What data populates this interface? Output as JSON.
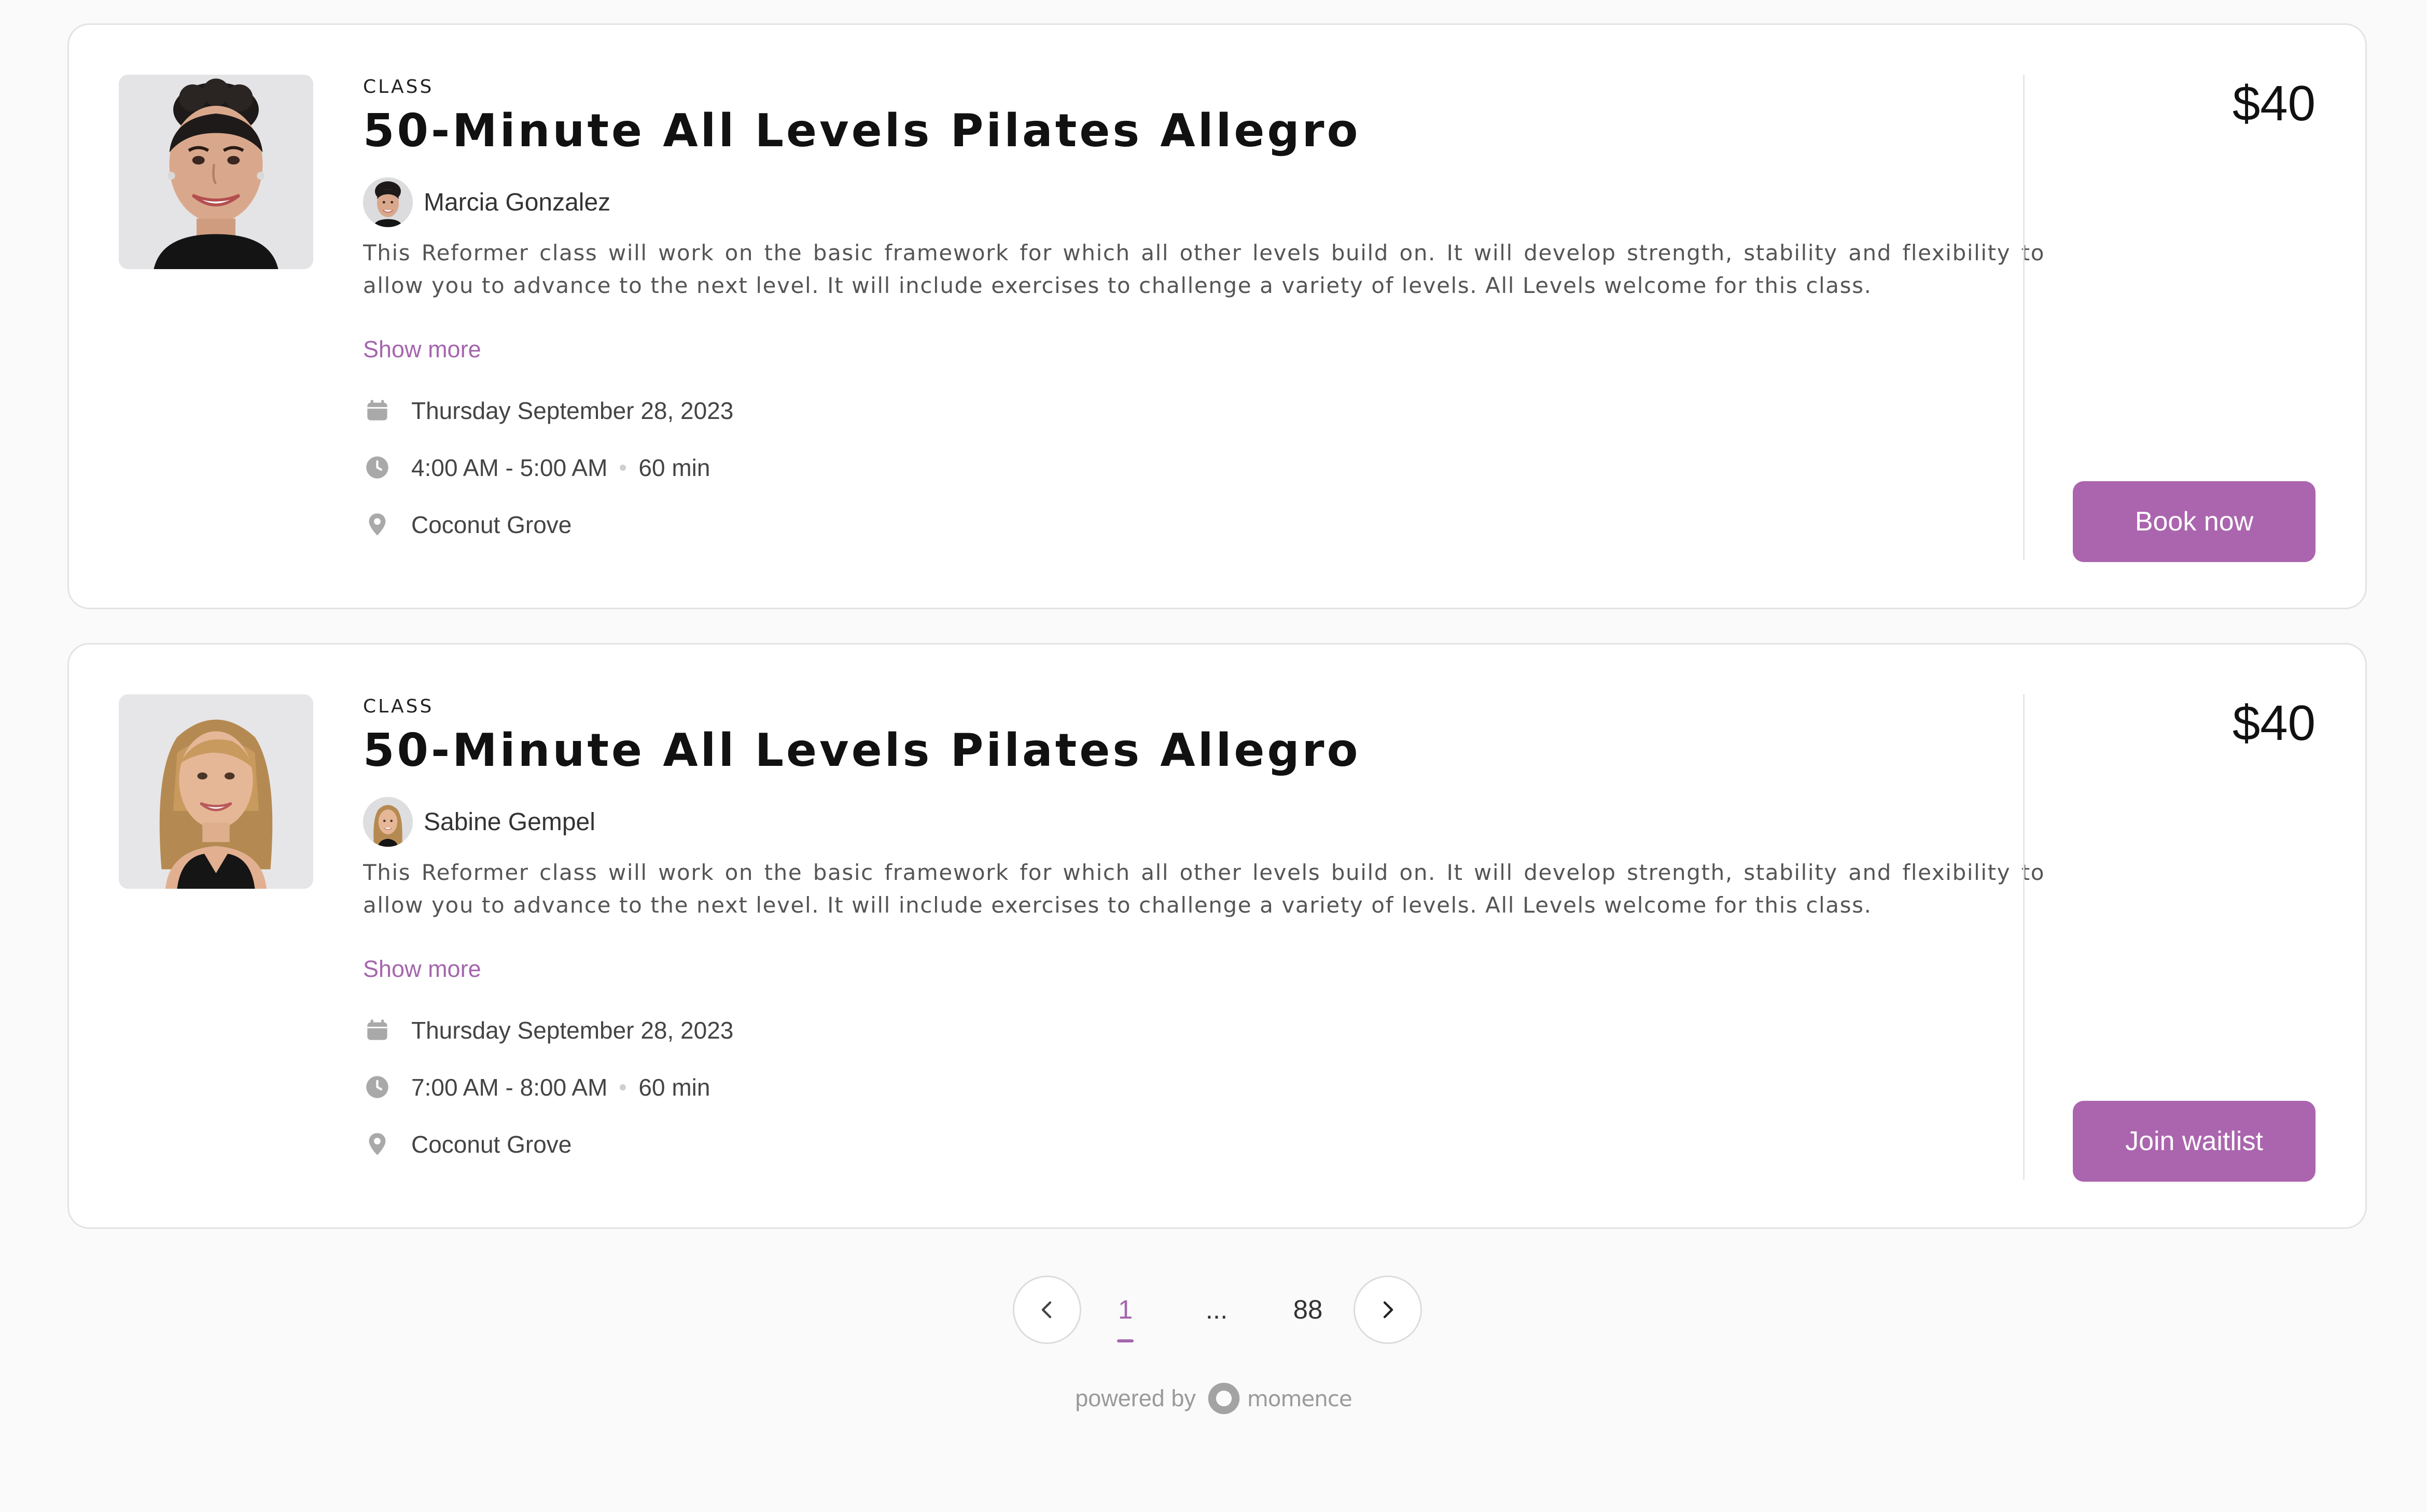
{
  "classes": [
    {
      "kind": "CLASS",
      "title": "50-Minute All Levels Pilates Allegro",
      "instructor": "Marcia Gonzalez",
      "description": "This Reformer class will work on the basic framework for which all other levels build on. It will develop strength, stability and flexibility to allow you to advance to the next level. It will include exercises to challenge a variety of levels. All Levels welcome for this class.",
      "show_more": "Show more",
      "date": "Thursday September 28, 2023",
      "time": "4:00 AM - 5:00 AM",
      "duration": "60 min",
      "location": "Coconut Grove",
      "price": "$40",
      "action": "Book now"
    },
    {
      "kind": "CLASS",
      "title": "50-Minute All Levels Pilates Allegro",
      "instructor": "Sabine Gempel",
      "description": "This Reformer class will work on the basic framework for which all other levels build on. It will develop strength, stability and flexibility to allow you to advance to the next level. It will include exercises to challenge a variety of levels. All Levels welcome for this class.",
      "show_more": "Show more",
      "date": "Thursday September 28, 2023",
      "time": "7:00 AM - 8:00 AM",
      "duration": "60 min",
      "location": "Coconut Grove",
      "price": "$40",
      "action": "Join waitlist"
    }
  ],
  "pagination": {
    "current": "1",
    "ellipsis": "...",
    "last": "88"
  },
  "footer": {
    "powered_by": "powered by",
    "brand": "momence"
  },
  "colors": {
    "accent": "#ab65ae",
    "link": "#a565ad",
    "background": "#fafafa",
    "card_border": "#e3e3e3"
  },
  "icons": [
    "calendar-icon",
    "clock-icon",
    "location-pin-icon",
    "chevron-left-icon",
    "chevron-right-icon",
    "momence-logo-icon"
  ]
}
